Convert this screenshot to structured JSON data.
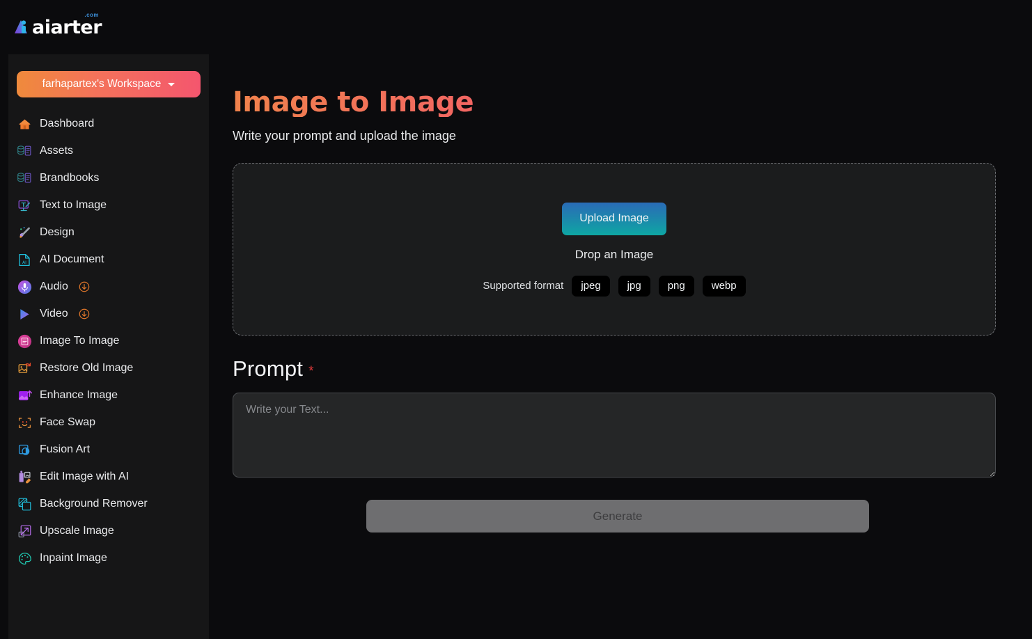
{
  "brand": {
    "name": "aiarter",
    "tld": ".com",
    "logo_icon": "triangle-person-logo-icon"
  },
  "sidebar": {
    "workspace": {
      "label": "farhapartex's Workspace",
      "caret_icon": "chevron-down-icon",
      "gradient_from": "#ef8a3c",
      "gradient_to": "#f4566e"
    },
    "items": [
      {
        "label": "Dashboard",
        "icon": "home-icon",
        "badge": null
      },
      {
        "label": "Assets",
        "icon": "assets-icon",
        "badge": null
      },
      {
        "label": "Brandbooks",
        "icon": "brandbooks-icon",
        "badge": null
      },
      {
        "label": "Text to Image",
        "icon": "text-to-image-icon",
        "badge": null
      },
      {
        "label": "Design",
        "icon": "design-icon",
        "badge": null
      },
      {
        "label": "AI Document",
        "icon": "ai-document-icon",
        "badge": null
      },
      {
        "label": "Audio",
        "icon": "audio-icon",
        "badge": "arrow-down-circle-icon"
      },
      {
        "label": "Video",
        "icon": "video-icon",
        "badge": "arrow-down-circle-icon"
      },
      {
        "label": "Image To Image",
        "icon": "image-to-image-icon",
        "badge": null
      },
      {
        "label": "Restore Old Image",
        "icon": "restore-old-image-icon",
        "badge": null
      },
      {
        "label": "Enhance Image",
        "icon": "enhance-image-icon",
        "badge": null
      },
      {
        "label": "Face Swap",
        "icon": "face-swap-icon",
        "badge": null
      },
      {
        "label": "Fusion Art",
        "icon": "fusion-art-icon",
        "badge": null
      },
      {
        "label": "Edit Image with AI",
        "icon": "edit-image-with-ai-icon",
        "badge": null
      },
      {
        "label": "Background Remover",
        "icon": "background-remover-icon",
        "badge": null
      },
      {
        "label": "Upscale Image",
        "icon": "upscale-image-icon",
        "badge": null
      },
      {
        "label": "Inpaint Image",
        "icon": "inpaint-image-icon",
        "badge": null
      }
    ]
  },
  "main": {
    "title": "Image to Image",
    "subtitle": "Write your prompt and upload the image",
    "title_gradient_from": "#f1834c",
    "title_gradient_to": "#f2566e",
    "upload": {
      "button_label": "Upload Image",
      "button_gradient_from": "#2a6bb7",
      "button_gradient_to": "#0ea7a4",
      "drop_text": "Drop an Image",
      "formats_label": "Supported format",
      "formats": [
        "jpeg",
        "jpg",
        "png",
        "webp"
      ]
    },
    "prompt": {
      "label": "Prompt",
      "required_marker": "*",
      "placeholder": "Write your Text...",
      "value": ""
    },
    "generate": {
      "label": "Generate",
      "disabled": true
    }
  }
}
